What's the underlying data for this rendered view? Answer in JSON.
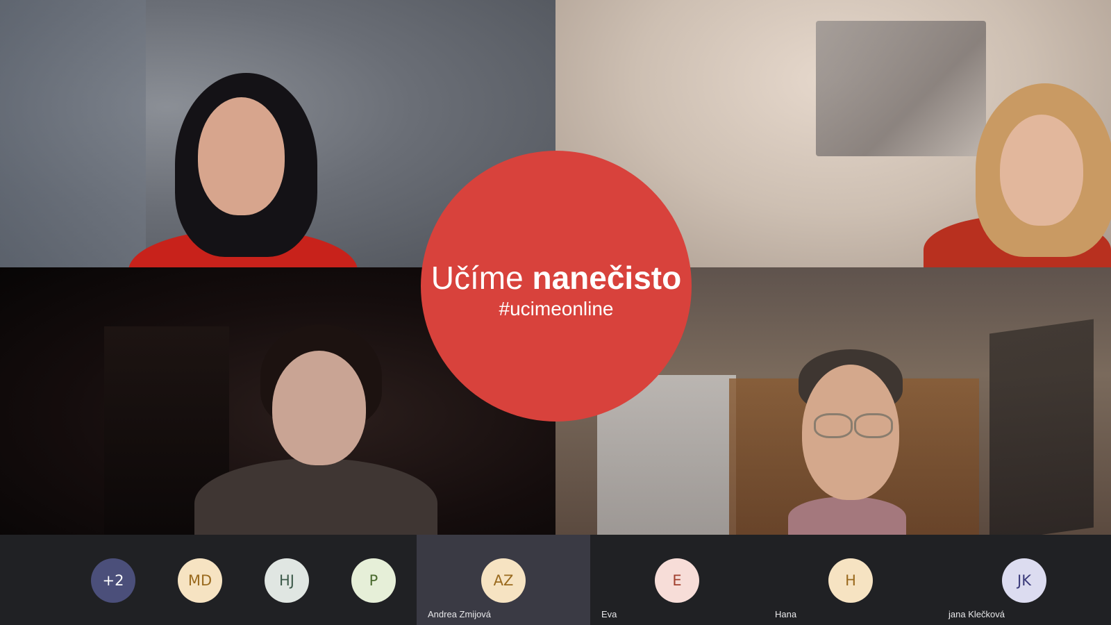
{
  "logo": {
    "title_light": "Učíme",
    "title_bold": "nanečisto",
    "hashtag": "#ucimeonline",
    "color": "#d8423c"
  },
  "participants": [
    {
      "initials": "+2",
      "name": "",
      "bg": "#4b4f7a",
      "fg": "#ffffff",
      "highlighted": false
    },
    {
      "initials": "MD",
      "name": "",
      "bg": "#f6e3c2",
      "fg": "#9a6a1e",
      "highlighted": false
    },
    {
      "initials": "HJ",
      "name": "",
      "bg": "#e0e6e2",
      "fg": "#3d5a4a",
      "highlighted": false
    },
    {
      "initials": "P",
      "name": "",
      "bg": "#e6efd8",
      "fg": "#4a6a2e",
      "highlighted": false
    },
    {
      "initials": "AZ",
      "name": "Andrea  Zmijová",
      "bg": "#f6e3c2",
      "fg": "#9a6a1e",
      "highlighted": true
    },
    {
      "initials": "E",
      "name": "Eva",
      "bg": "#f7ddd8",
      "fg": "#a1402f",
      "highlighted": false
    },
    {
      "initials": "H",
      "name": "Hana",
      "bg": "#f6e3c2",
      "fg": "#9a6a1e",
      "highlighted": false
    },
    {
      "initials": "JK",
      "name": "jana Klečková",
      "bg": "#dcdcf0",
      "fg": "#3a3a7a",
      "highlighted": false
    }
  ]
}
